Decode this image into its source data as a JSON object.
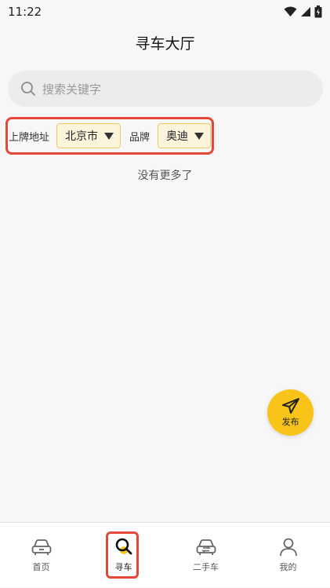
{
  "status": {
    "time": "11:22"
  },
  "header": {
    "title": "寻车大厅"
  },
  "search": {
    "placeholder": "搜索关键字"
  },
  "filters": {
    "location_label": "上牌地址",
    "location_value": "北京市",
    "brand_label": "品牌",
    "brand_value": "奥迪"
  },
  "list": {
    "empty_text": "没有更多了"
  },
  "fab": {
    "label": "发布"
  },
  "colors": {
    "accent": "#f8c41a",
    "highlight": "#e2493a"
  },
  "tabbar": {
    "items": [
      {
        "label": "首页",
        "icon": "car-icon"
      },
      {
        "label": "寻车",
        "icon": "search-car-icon",
        "active": true
      },
      {
        "label": "二手车",
        "icon": "exchange-car-icon"
      },
      {
        "label": "我的",
        "icon": "user-icon"
      }
    ]
  }
}
